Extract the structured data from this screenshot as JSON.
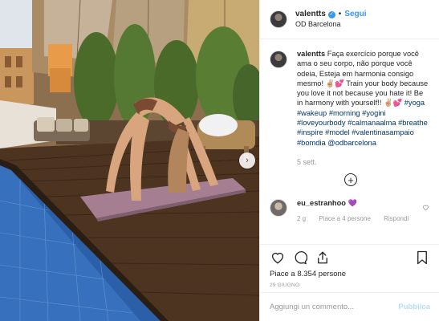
{
  "post": {
    "username": "valentts",
    "follow_label": "Segui",
    "separator": "•",
    "location": "OD Barcelona",
    "carousel_next_glyph": "›"
  },
  "caption": {
    "username": "valentts",
    "text_1": "Faça exercício porque você ama o seu corpo, não porque você odeia, Esteja em harmonia consigo mesmo! ✌🏼💕 Train your body because you love it not because you hate it! Be in harmony with yourself!! ✌🏼💕",
    "hashtags": [
      "#yoga",
      "#wakeup",
      "#morning",
      "#yogini",
      "#loveyourbody",
      "#calmanaalma",
      "#breathe",
      "#inspire",
      "#model",
      "#valentinasampaio",
      "#bomdia"
    ],
    "mention": "@odbarcelona",
    "age": "5 sett.",
    "load_more_glyph": "+"
  },
  "comments": [
    {
      "username": "eu_estranhoo",
      "text": "💜",
      "age": "2 g",
      "likes": "Piace a 4 persone",
      "reply_label": "Rispondi",
      "like_icon": "heart-outline-icon"
    }
  ],
  "engagement": {
    "likes_text": "Piace a 8.354 persone",
    "date": "29 GIUGNO"
  },
  "add_comment": {
    "placeholder": "Aggiungi un commento...",
    "publish_label": "Pubblica"
  },
  "colors": {
    "link_blue": "#3897f0",
    "hashtag": "#003569",
    "muted": "#999999",
    "publish_disabled": "#b2dffc"
  }
}
